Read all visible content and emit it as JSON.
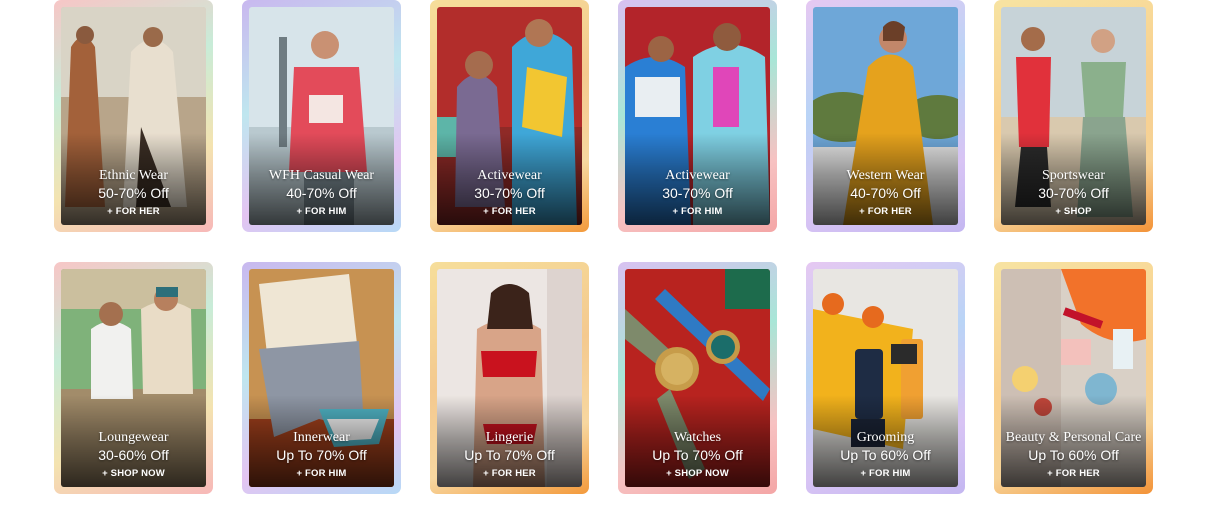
{
  "tiles": [
    {
      "category": "Ethnic Wear",
      "offer": "50-70% Off",
      "cta": "+ FOR HER"
    },
    {
      "category": "WFH Casual Wear",
      "offer": "40-70% Off",
      "cta": "+ FOR HIM"
    },
    {
      "category": "Activewear",
      "offer": "30-70% Off",
      "cta": "+ FOR HER"
    },
    {
      "category": "Activewear",
      "offer": "30-70% Off",
      "cta": "+ FOR HIM"
    },
    {
      "category": "Western Wear",
      "offer": "40-70% Off",
      "cta": "+ FOR HER"
    },
    {
      "category": "Sportswear",
      "offer": "30-70% Off",
      "cta": "+ SHOP"
    },
    {
      "category": "Loungewear",
      "offer": "30-60% Off",
      "cta": "+ SHOP NOW"
    },
    {
      "category": "Innerwear",
      "offer": "Up To 70% Off",
      "cta": "+ FOR HIM"
    },
    {
      "category": "Lingerie",
      "offer": "Up To 70% Off",
      "cta": "+ FOR HER"
    },
    {
      "category": "Watches",
      "offer": "Up To 70% Off",
      "cta": "+ SHOP NOW"
    },
    {
      "category": "Grooming",
      "offer": "Up To 60% Off",
      "cta": "+ FOR HIM"
    },
    {
      "category": "Beauty & Personal Care",
      "offer": "Up To 60% Off",
      "cta": "+ FOR HER"
    }
  ]
}
